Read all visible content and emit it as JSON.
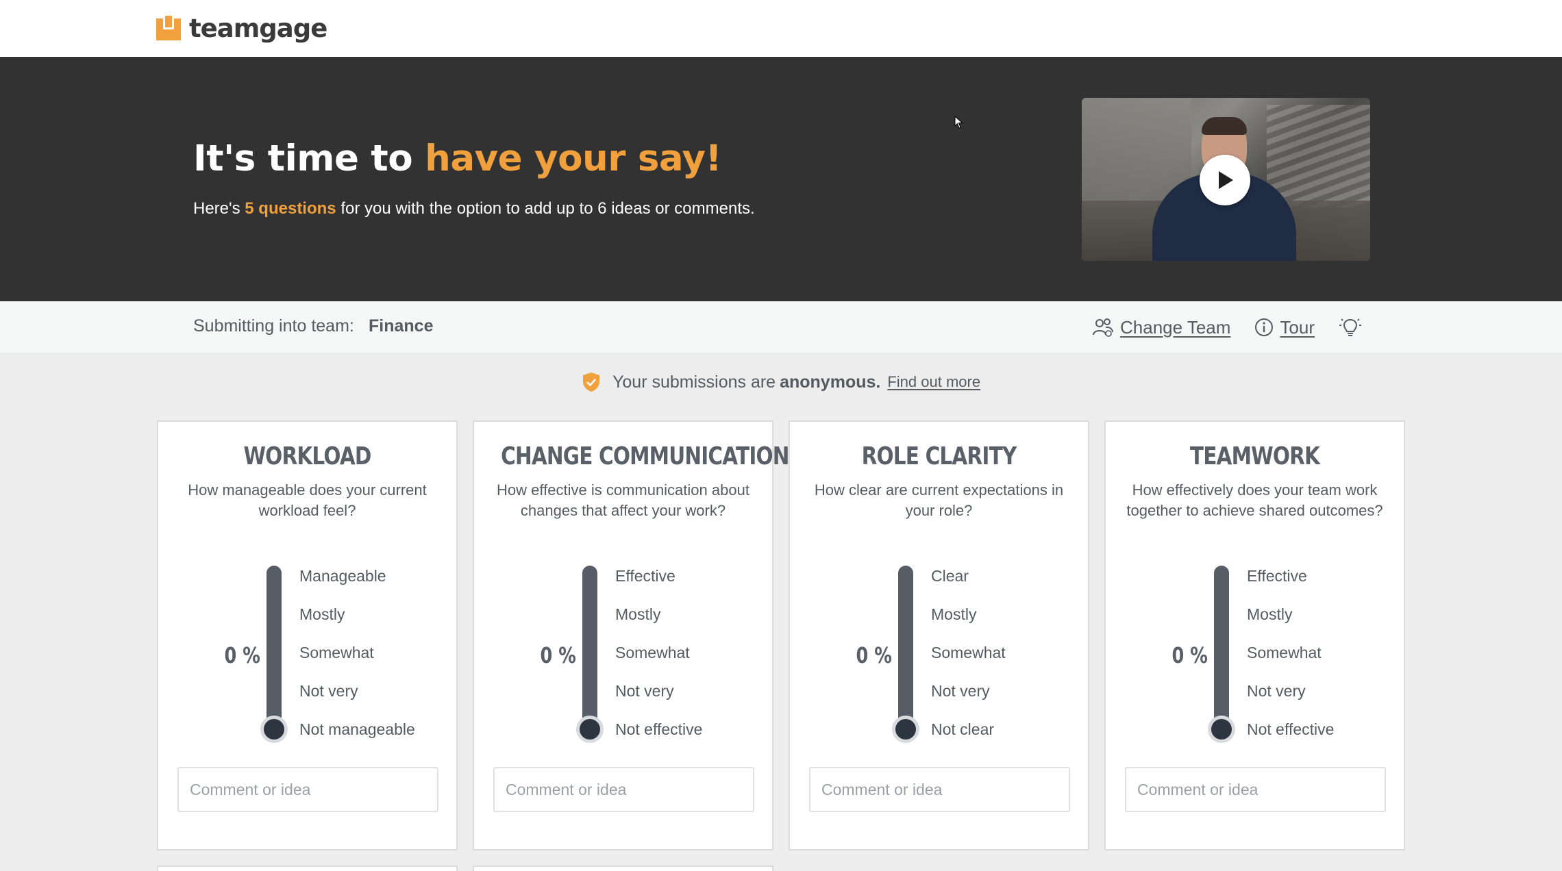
{
  "brand": {
    "name": "teamgage",
    "accent": "#f0a03c",
    "dark": "#333232"
  },
  "hero": {
    "title_start": "It's time to",
    "title_accent": "have your say!",
    "sub_start": "Here's",
    "sub_accent": "5 questions",
    "sub_end": "for you with the option to add up to 6 ideas or comments."
  },
  "video": {
    "thumbnail": "presenter-video",
    "play_icon": "play-icon"
  },
  "team_bar": {
    "label": "Submitting into team:",
    "team": "Finance",
    "change_team": "Change Team",
    "tour": "Tour",
    "ideas_icon": "lightbulb-icon"
  },
  "anonymous": {
    "text": "Your submissions are",
    "bold": "anonymous.",
    "link": "Find out more"
  },
  "cards": [
    {
      "title": "WORKLOAD",
      "question": "How manageable does your current workload feel?",
      "percent": "0 %",
      "options": [
        "Manageable",
        "Mostly",
        "Somewhat",
        "Not very",
        "Not manageable"
      ],
      "comment_placeholder": "Comment or idea"
    },
    {
      "title": "CHANGE COMMUNICATION",
      "question": "How effective is communication about changes that affect your work?",
      "percent": "0 %",
      "options": [
        "Effective",
        "Mostly",
        "Somewhat",
        "Not very",
        "Not effective"
      ],
      "comment_placeholder": "Comment or idea"
    },
    {
      "title": "ROLE CLARITY",
      "question": "How clear are current expectations in your role?",
      "percent": "0 %",
      "options": [
        "Clear",
        "Mostly",
        "Somewhat",
        "Not very",
        "Not clear"
      ],
      "comment_placeholder": "Comment or idea"
    },
    {
      "title": "TEAMWORK",
      "question": "How effectively does your team work together to achieve shared outcomes?",
      "percent": "0 %",
      "options": [
        "Effective",
        "Mostly",
        "Somewhat",
        "Not very",
        "Not effective"
      ],
      "comment_placeholder": "Comment or idea"
    }
  ]
}
